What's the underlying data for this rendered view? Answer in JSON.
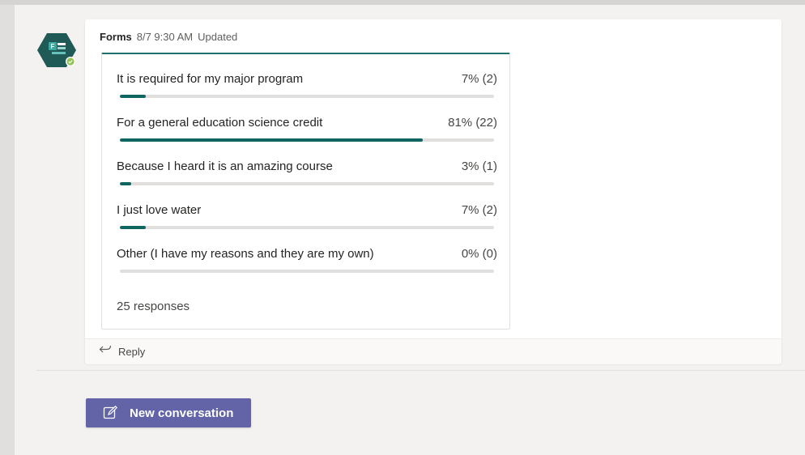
{
  "message": {
    "app_name": "Forms",
    "timestamp": "8/7 9:30 AM",
    "status": "Updated"
  },
  "poll": {
    "options": [
      {
        "label": "It is required for my major program",
        "value": "7% (2)",
        "fraction": 0.07
      },
      {
        "label": "For a general education science credit",
        "value": "81% (22)",
        "fraction": 0.81
      },
      {
        "label": "Because I heard it is an amazing course",
        "value": "3% (1)",
        "fraction": 0.03
      },
      {
        "label": "I just love water",
        "value": "7% (2)",
        "fraction": 0.07
      },
      {
        "label": "Other (I have my reasons and they are my own)",
        "value": "0% (0)",
        "fraction": 0.0
      }
    ],
    "responses": "25 responses"
  },
  "reply": {
    "label": "Reply",
    "icon": "reply-arrow-icon"
  },
  "new_conversation": {
    "label": "New conversation",
    "icon": "compose-icon"
  },
  "avatar": {
    "icon": "forms-app-icon",
    "presence": "available"
  },
  "colors": {
    "accent": "#6264a7",
    "bar_fill": "#0f6660",
    "avatar_bg": "#1f5a57",
    "presence": "#92c353"
  }
}
